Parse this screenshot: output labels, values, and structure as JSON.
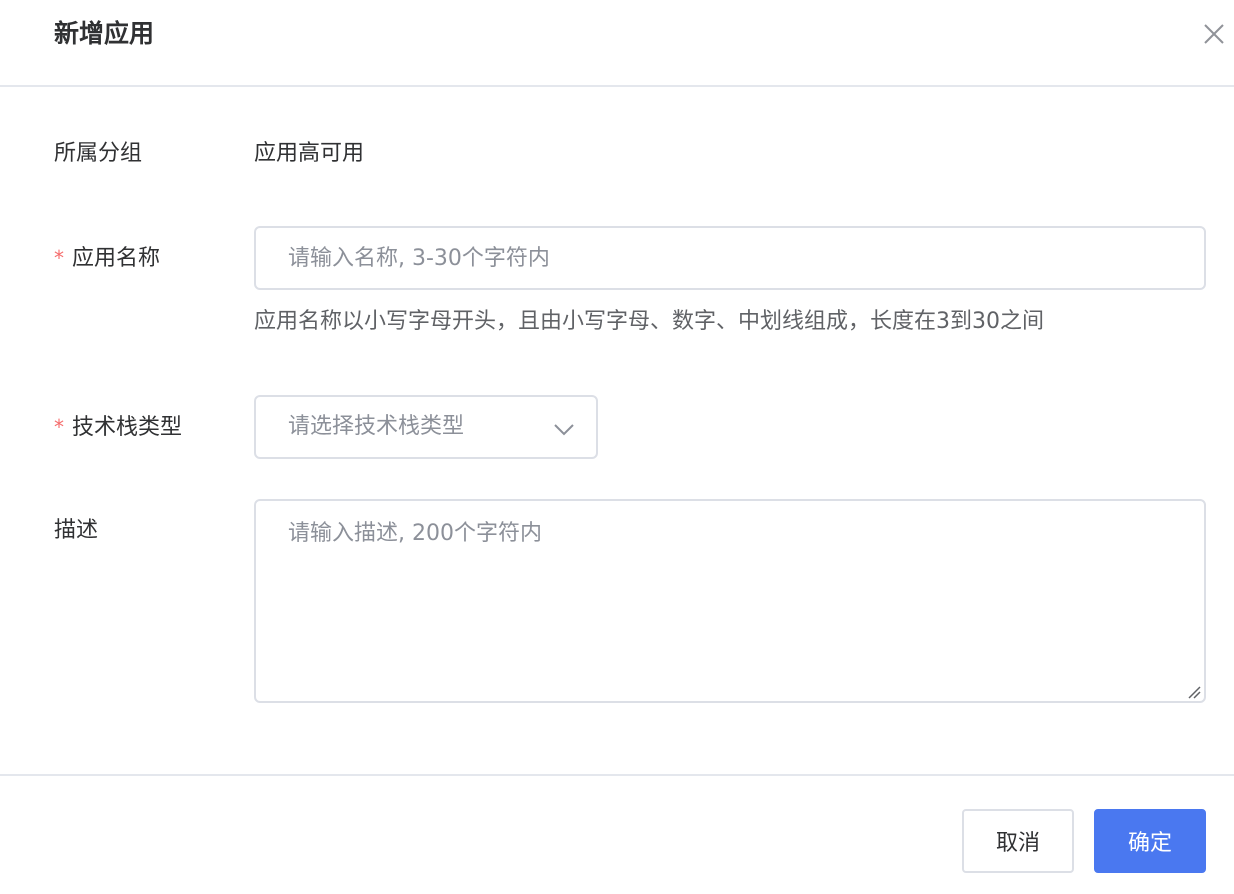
{
  "dialog": {
    "title": "新增应用"
  },
  "form": {
    "group": {
      "label": "所属分组",
      "value": "应用高可用"
    },
    "app_name": {
      "required_mark": "*",
      "label": "应用名称",
      "placeholder": "请输入名称, 3-30个字符内",
      "value": "",
      "hint": "应用名称以小写字母开头，且由小写字母、数字、中划线组成，长度在3到30之间"
    },
    "tech_stack": {
      "required_mark": "*",
      "label": "技术栈类型",
      "placeholder": "请选择技术栈类型"
    },
    "description": {
      "label": "描述",
      "placeholder": "请输入描述, 200个字符内",
      "value": ""
    }
  },
  "footer": {
    "cancel_label": "取消",
    "ok_label": "确定"
  },
  "colors": {
    "primary": "#4a78f0",
    "required": "#f56c6c",
    "border": "#dcdfe6",
    "divider": "#e4e7ed"
  },
  "icons": {
    "close": "close-icon",
    "select_arrow": "chevron-down-icon",
    "resize": "resize-grip-icon"
  }
}
